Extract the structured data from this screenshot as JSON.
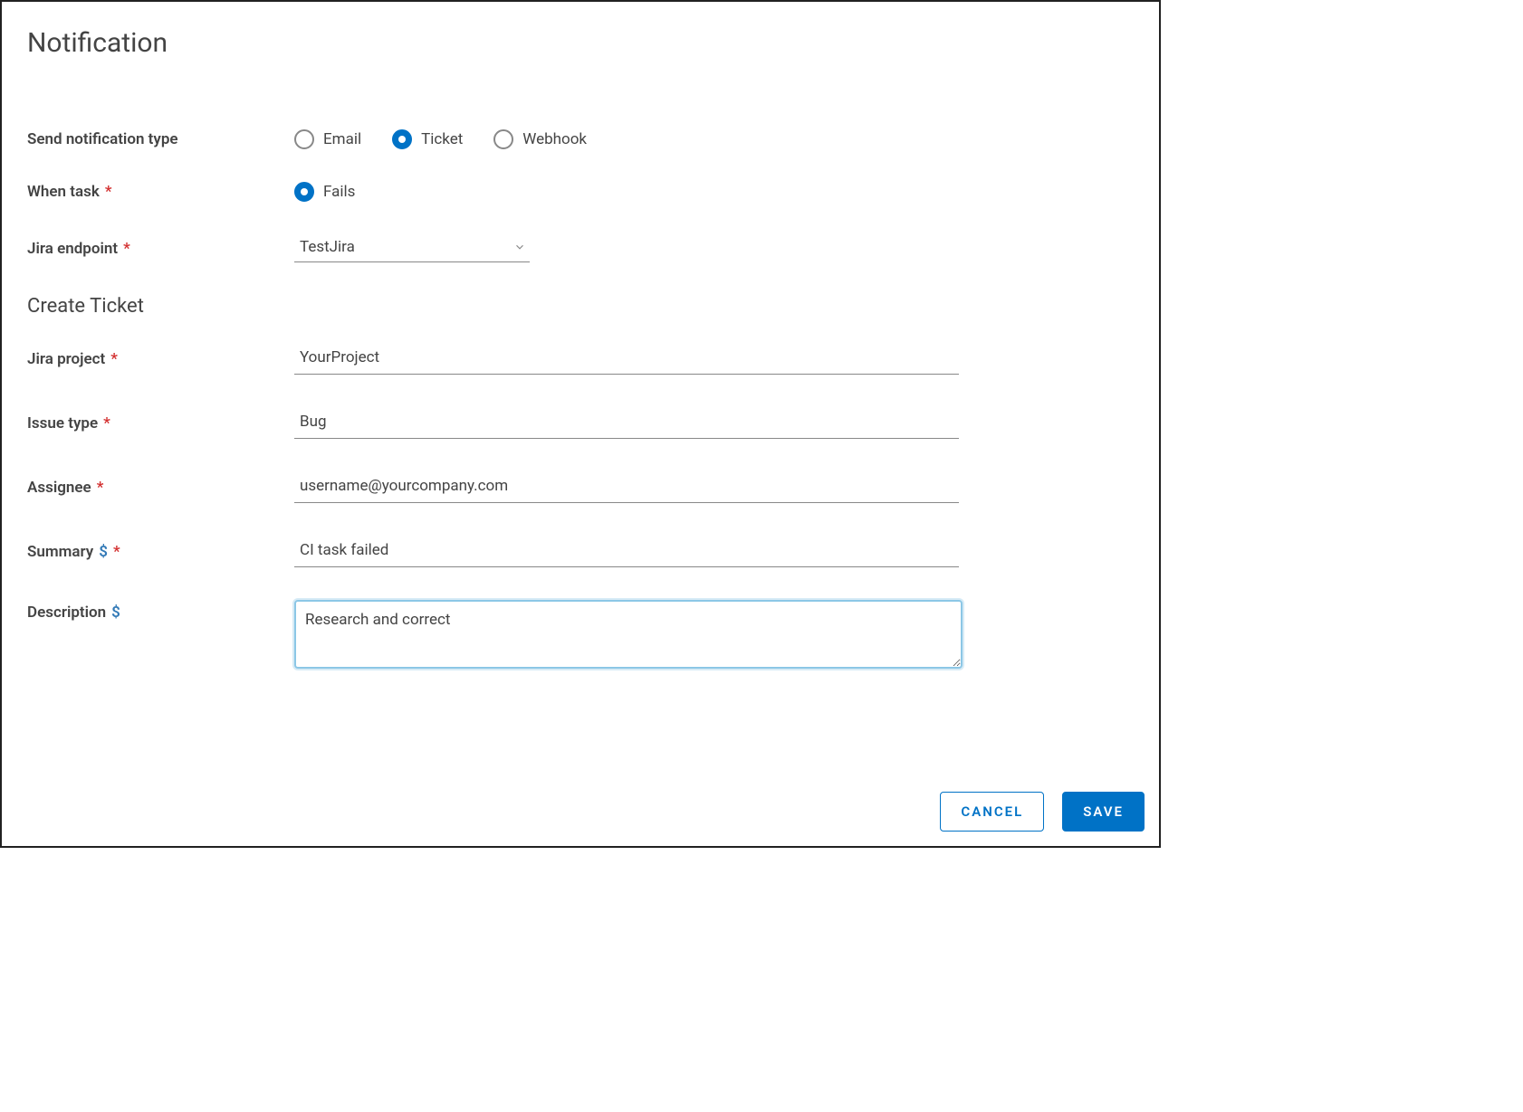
{
  "page": {
    "title": "Notification"
  },
  "labels": {
    "notification_type": "Send notification type",
    "when_task": "When task",
    "jira_endpoint": "Jira endpoint",
    "create_ticket": "Create Ticket",
    "jira_project": "Jira project",
    "issue_type": "Issue type",
    "assignee": "Assignee",
    "summary": "Summary",
    "description": "Description"
  },
  "notification_type": {
    "options": {
      "email": "Email",
      "ticket": "Ticket",
      "webhook": "Webhook"
    },
    "selected": "ticket"
  },
  "when_task": {
    "options": {
      "fails": "Fails"
    },
    "selected": "fails"
  },
  "jira_endpoint": {
    "value": "TestJira"
  },
  "fields": {
    "jira_project": "YourProject",
    "issue_type": "Bug",
    "assignee": "username@yourcompany.com",
    "summary": "CI task failed",
    "description": "Research and correct"
  },
  "buttons": {
    "cancel": "CANCEL",
    "save": "SAVE"
  }
}
